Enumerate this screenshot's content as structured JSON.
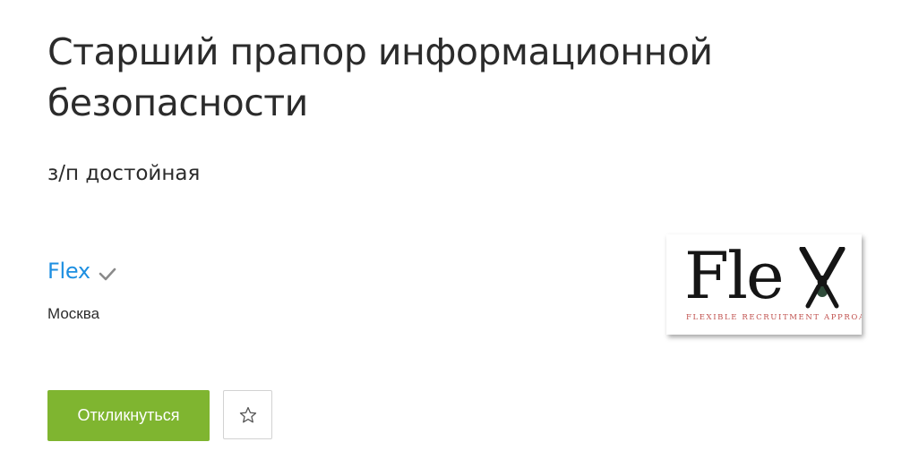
{
  "vacancy": {
    "title": "Старший прапор информационной безопасности",
    "salary": "з/п достойная"
  },
  "company": {
    "name": "Flex",
    "verified_icon": "checkmark-icon",
    "city": "Москва",
    "logo": {
      "word": "Fle",
      "tagline": "FLEXIBLE RECRUITMENT APPROACH"
    }
  },
  "actions": {
    "apply_label": "Откликнуться",
    "favorite_icon": "star-outline-icon"
  },
  "colors": {
    "link": "#1d8fe1",
    "apply_button": "#7fb530",
    "text": "#2b2b2b",
    "logo_accent": "#c0504d"
  }
}
